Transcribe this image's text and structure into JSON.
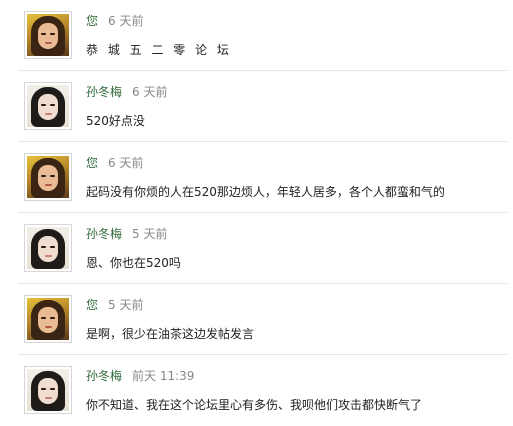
{
  "messages": [
    {
      "author": "您",
      "time": "6 天前",
      "text": "恭 城 五 二 零 论 坛",
      "avatar": "woman-brown-hair"
    },
    {
      "author": "孙冬梅",
      "time": "6 天前",
      "text": "520好点没",
      "avatar": "woman-black-hair"
    },
    {
      "author": "您",
      "time": "6 天前",
      "text": "起码没有你烦的人在520那边烦人，年轻人居多，各个人都蛮和气的",
      "avatar": "woman-brown-hair"
    },
    {
      "author": "孙冬梅",
      "time": "5 天前",
      "text": "恩、你也在520吗",
      "avatar": "woman-black-hair"
    },
    {
      "author": "您",
      "time": "5 天前",
      "text": "是啊，很少在油茶这边发帖发言",
      "avatar": "woman-brown-hair"
    },
    {
      "author": "孙冬梅",
      "time": "前天 11:39",
      "text": "你不知道、我在这个论坛里心有多伤、我呗他们攻击都快断气了",
      "avatar": "woman-black-hair"
    }
  ],
  "colors": {
    "author": "#2f6b39",
    "time": "#888888",
    "text": "#222222",
    "divider": "#e5e5e5"
  }
}
